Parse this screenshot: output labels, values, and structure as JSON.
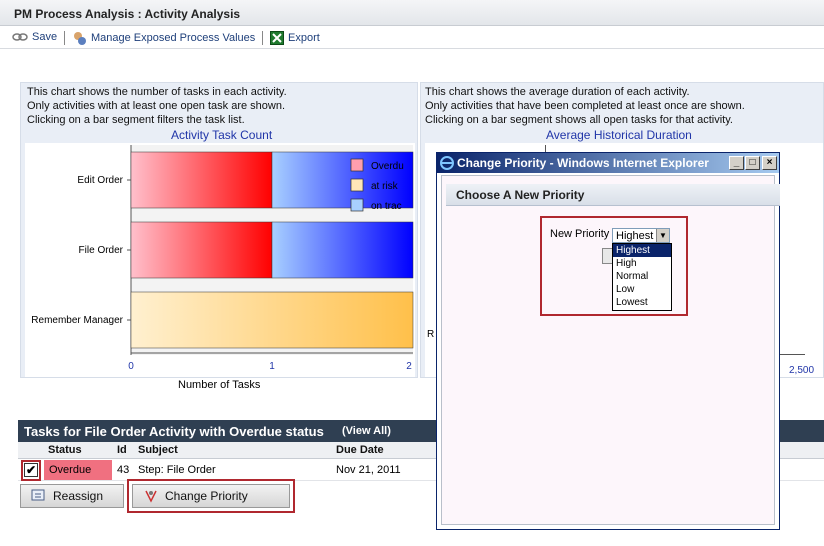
{
  "window": {
    "title": "PM Process Analysis : Activity Analysis"
  },
  "toolbar": {
    "save": "Save",
    "manage": "Manage Exposed Process Values",
    "export": "Export"
  },
  "left_panel": {
    "desc": [
      "This chart shows the number of tasks in each activity.",
      "Only activities with at least one open task are shown.",
      "Clicking on a bar segment filters the task list."
    ],
    "title": "Activity Task Count",
    "xlabel": "Number of Tasks",
    "legend": [
      "Overdu",
      "at risk",
      "on trac"
    ]
  },
  "right_panel": {
    "desc": [
      "This chart shows the average duration of each activity.",
      "Only activities that have been completed at least once are shown.",
      "Clicking on a bar segment shows all open tasks for that activity."
    ],
    "title": "Average Historical Duration",
    "tick_max": "2,500",
    "partial_label": "R"
  },
  "grid": {
    "title": "Tasks for File Order Activity with Overdue status",
    "view_all": "(View All)",
    "columns": [
      "Status",
      "Id",
      "Subject",
      "Due Date"
    ],
    "row": {
      "checked": true,
      "status": "Overdue",
      "id": "43",
      "subject": "Step: File Order",
      "due": "Nov 21, 2011"
    }
  },
  "buttons": {
    "reassign": "Reassign",
    "change_priority": "Change Priority"
  },
  "popup": {
    "title": "Change Priority - Windows Internet Explorer",
    "section": "Choose A New Priority",
    "label": "New Priority",
    "selected": "Highest",
    "options": [
      "Highest",
      "High",
      "Normal",
      "Low",
      "Lowest"
    ]
  },
  "colors": {
    "overdue": "#ff0000",
    "at_risk": "#ffc04a",
    "on_track": "#0000ff",
    "grid_header": "#2f3f52",
    "accent": "#b0282f"
  },
  "chart_data": {
    "type": "bar",
    "orientation": "horizontal",
    "stacked": true,
    "title": "Activity Task Count",
    "xlabel": "Number of Tasks",
    "categories": [
      "Edit Order",
      "File Order",
      "Remember Manager"
    ],
    "series": [
      {
        "name": "Overdue",
        "values": [
          1,
          1,
          0
        ]
      },
      {
        "name": "at risk",
        "values": [
          0,
          0,
          2
        ]
      },
      {
        "name": "on track",
        "values": [
          1,
          1,
          0
        ]
      }
    ],
    "xlim": [
      0,
      2
    ],
    "xticks": [
      "0",
      "1",
      "2"
    ]
  }
}
